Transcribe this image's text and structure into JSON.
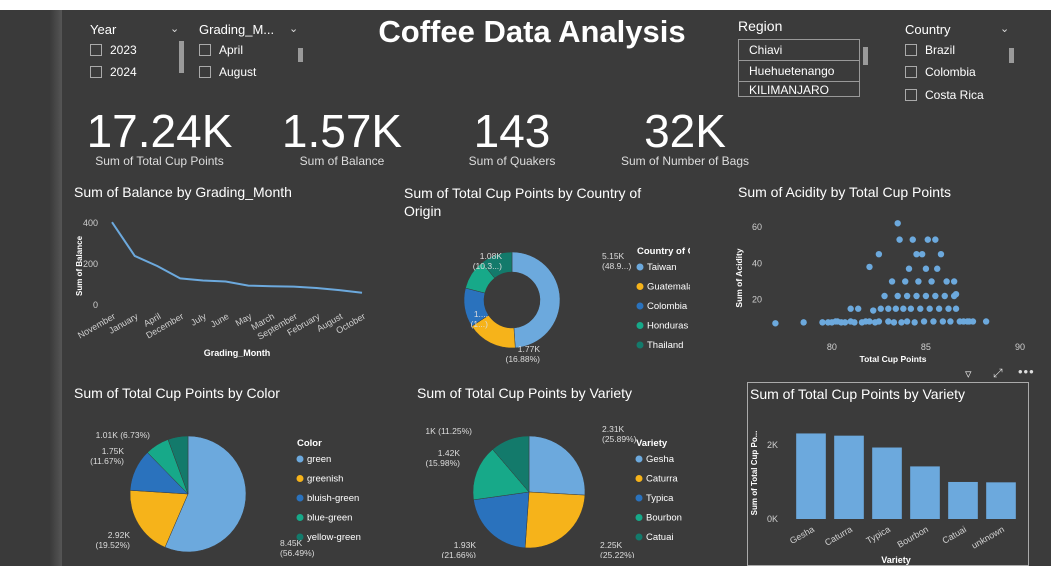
{
  "dashboard_title": "Coffee Data Analysis",
  "slicers": {
    "year": {
      "title": "Year",
      "items": [
        "2023",
        "2024"
      ]
    },
    "grading_month": {
      "title": "Grading_M...",
      "items": [
        "April",
        "August"
      ]
    },
    "region": {
      "title": "Region",
      "items": [
        "Chiavi",
        "Huehuetenango",
        "KILIMANJARO"
      ]
    },
    "country": {
      "title": "Country",
      "items": [
        "Brazil",
        "Colombia",
        "Costa Rica"
      ]
    }
  },
  "kpis": [
    {
      "value": "17.24K",
      "label": "Sum of Total Cup Points"
    },
    {
      "value": "1.57K",
      "label": "Sum of Balance"
    },
    {
      "value": "143",
      "label": "Sum of Quakers"
    },
    {
      "value": "32K",
      "label": "Sum of Number of Bags"
    }
  ],
  "colors": {
    "c1": "#6ca9dd",
    "c2": "#f6b31a",
    "c3": "#2a72bd",
    "c4": "#17a989",
    "c5": "#137a6b",
    "line": "#6ca9dd",
    "axis": "#cfcfcf"
  },
  "chart_data": [
    {
      "type": "line",
      "title": "Sum of Balance by Grading_Month",
      "xlabel": "Grading_Month",
      "ylabel": "Sum of Balance",
      "categories": [
        "November",
        "January",
        "April",
        "December",
        "July",
        "June",
        "May",
        "March",
        "September",
        "February",
        "August",
        "October"
      ],
      "values": [
        400,
        235,
        185,
        125,
        115,
        110,
        90,
        87,
        85,
        78,
        68,
        55
      ],
      "ylim": [
        0,
        430
      ],
      "yticks": [
        0,
        200,
        400
      ],
      "grid": false
    },
    {
      "type": "pie",
      "subtype": "donut",
      "title": "Sum of Total Cup Points by Country of Origin",
      "legend_title": "Country of Origin",
      "categories": [
        "Taiwan",
        "Guatemala",
        "Colombia",
        "Honduras",
        "Thailand"
      ],
      "values": [
        48.9,
        16.88,
        13.2,
        10.3,
        10.7
      ],
      "data_labels": [
        {
          "text": "5.15K",
          "sub": "(48.9...)"
        },
        {
          "text": "1.77K",
          "sub": "(16.88%)"
        },
        {
          "text": "1....",
          "sub": "(1...)"
        },
        {
          "text": "1.08K",
          "sub": "(10.3...)"
        },
        {
          "text": "",
          "sub": ""
        }
      ]
    },
    {
      "type": "scatter",
      "title": "Sum of Acidity by Total Cup Points",
      "xlabel": "Total Cup Points",
      "ylabel": "Sum of Acidity",
      "xlim": [
        76.5,
        90
      ],
      "ylim": [
        0,
        66
      ],
      "xticks": [
        80,
        85,
        90
      ],
      "yticks": [
        20,
        40,
        60
      ],
      "points": [
        [
          77,
          7
        ],
        [
          78.5,
          7.5
        ],
        [
          79.5,
          7.5
        ],
        [
          79.8,
          7.5
        ],
        [
          80,
          7.5
        ],
        [
          80.2,
          8
        ],
        [
          80.5,
          7.5
        ],
        [
          80.7,
          7.5
        ],
        [
          81,
          8
        ],
        [
          81.2,
          7.5
        ],
        [
          81.4,
          15
        ],
        [
          81.6,
          7.5
        ],
        [
          81.8,
          8
        ],
        [
          82,
          8
        ],
        [
          82.2,
          14
        ],
        [
          82.3,
          7.5
        ],
        [
          82.5,
          8
        ],
        [
          82.6,
          15
        ],
        [
          82.8,
          22
        ],
        [
          83,
          8
        ],
        [
          83,
          15
        ],
        [
          83.2,
          30
        ],
        [
          83.3,
          7.5
        ],
        [
          83.4,
          15
        ],
        [
          83.5,
          22
        ],
        [
          83.6,
          53
        ],
        [
          83.7,
          7.5
        ],
        [
          83.8,
          15
        ],
        [
          83.9,
          30
        ],
        [
          84,
          8
        ],
        [
          84,
          22
        ],
        [
          84.1,
          37
        ],
        [
          84.2,
          15
        ],
        [
          84.3,
          53
        ],
        [
          84.4,
          7.5
        ],
        [
          84.5,
          22
        ],
        [
          84.6,
          30
        ],
        [
          84.7,
          15
        ],
        [
          84.8,
          45
        ],
        [
          84.9,
          8
        ],
        [
          85,
          22
        ],
        [
          85,
          37
        ],
        [
          85.1,
          53
        ],
        [
          85.2,
          15
        ],
        [
          85.3,
          30
        ],
        [
          85.4,
          8
        ],
        [
          85.5,
          22
        ],
        [
          85.6,
          37
        ],
        [
          85.7,
          15
        ],
        [
          85.8,
          45
        ],
        [
          85.9,
          8
        ],
        [
          86,
          22
        ],
        [
          86.1,
          30
        ],
        [
          86.2,
          15
        ],
        [
          86.3,
          8
        ],
        [
          86.5,
          22
        ],
        [
          86.6,
          15
        ],
        [
          86.8,
          8
        ],
        [
          87,
          8
        ],
        [
          87.2,
          8
        ],
        [
          87.3,
          8
        ],
        [
          87.5,
          8
        ],
        [
          88.2,
          8
        ],
        [
          82.5,
          45
        ],
        [
          83.5,
          62
        ],
        [
          84.5,
          45
        ],
        [
          82,
          38
        ],
        [
          85.5,
          53
        ],
        [
          86.5,
          30
        ],
        [
          81,
          15
        ],
        [
          80.3,
          8
        ],
        [
          86.6,
          23
        ]
      ],
      "grid": false
    },
    {
      "type": "pie",
      "title": "Sum of Total Cup Points by Color",
      "legend_title": "Color",
      "categories": [
        "green",
        "greenish",
        "bluish-green",
        "blue-green",
        "yellow-green"
      ],
      "values": [
        56.49,
        19.52,
        11.67,
        6.73,
        5.59
      ],
      "data_labels": [
        {
          "text": "8.45K",
          "sub": "(56.49%)"
        },
        {
          "text": "2.92K",
          "sub": "(19.52%)"
        },
        {
          "text": "1.75K",
          "sub": "(11.67%)"
        },
        {
          "text": "1.01K (6.73%)",
          "sub": ""
        },
        {
          "text": "",
          "sub": ""
        }
      ]
    },
    {
      "type": "pie",
      "title": "Sum of Total Cup Points by Variety",
      "legend_title": "Variety",
      "categories": [
        "Gesha",
        "Caturra",
        "Typica",
        "Bourbon",
        "Catuai"
      ],
      "values": [
        25.89,
        25.22,
        21.66,
        15.98,
        11.25
      ],
      "data_labels": [
        {
          "text": "2.31K",
          "sub": "(25.89%)"
        },
        {
          "text": "2.25K",
          "sub": "(25.22%)"
        },
        {
          "text": "1.93K",
          "sub": "(21.66%)"
        },
        {
          "text": "1.42K",
          "sub": "(15.98%)"
        },
        {
          "text": "1K (11.25%)",
          "sub": ""
        }
      ]
    },
    {
      "type": "bar",
      "title": "Sum of Total Cup Points by Variety",
      "xlabel": "Variety",
      "ylabel": "Sum of Total Cup Po...",
      "categories": [
        "Gesha",
        "Caturra",
        "Typica",
        "Bourbon",
        "Catuai",
        "unknown"
      ],
      "values": [
        2310,
        2250,
        1930,
        1420,
        1000,
        990
      ],
      "ylim": [
        0,
        2700
      ],
      "yticks": [
        0,
        2000
      ],
      "ytick_labels": [
        "0K",
        "2K"
      ]
    }
  ]
}
